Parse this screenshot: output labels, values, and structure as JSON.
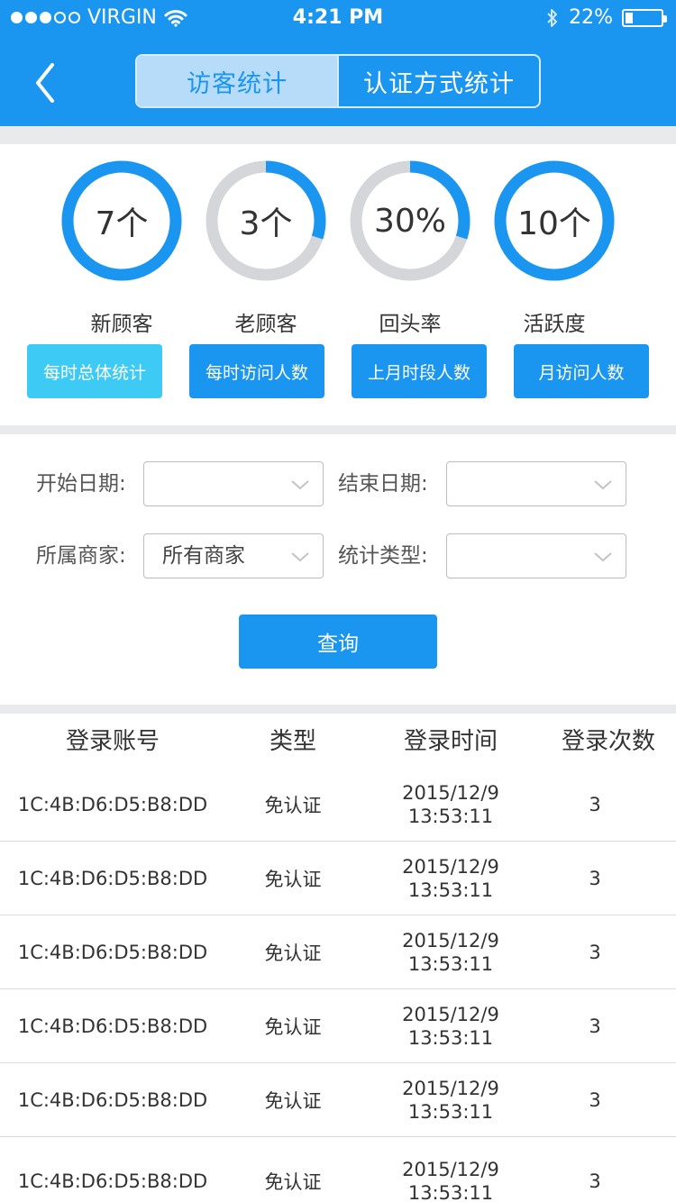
{
  "status_bar": {
    "carrier": "VIRGIN",
    "time": "4:21 PM",
    "battery": "22%",
    "battery_level": 0.22,
    "signal_bars_filled": 3,
    "signal_bars_total": 5
  },
  "nav": {
    "tabs": [
      {
        "label": "访客统计",
        "active": true
      },
      {
        "label": "认证方式统计",
        "active": false
      }
    ]
  },
  "stats": [
    {
      "value": "7个",
      "label": "新顾客",
      "progress": 1.0
    },
    {
      "value": "3个",
      "label": "老顾客",
      "progress": 0.3
    },
    {
      "value": "30%",
      "label": "回头率",
      "progress": 0.3
    },
    {
      "value": "10个",
      "label": "活跃度",
      "progress": 1.0
    }
  ],
  "stat_buttons": [
    {
      "label": "每时总体统计"
    },
    {
      "label": "每时访问人数"
    },
    {
      "label": "上月时段人数"
    },
    {
      "label": "月访问人数"
    }
  ],
  "filters": {
    "start_date_label": "开始日期:",
    "start_date_value": "",
    "end_date_label": "结束日期:",
    "end_date_value": "",
    "merchant_label": "所属商家:",
    "merchant_value": "所有商家",
    "type_label": "统计类型:",
    "type_value": "",
    "query_button": "查询"
  },
  "table": {
    "headers": [
      "登录账号",
      "类型",
      "登录时间",
      "登录次数"
    ],
    "rows": [
      {
        "account": "1C:4B:D6:D5:B8:DD",
        "type": "免认证",
        "date": "2015/12/9",
        "time": "13:53:11",
        "count": "3"
      },
      {
        "account": "1C:4B:D6:D5:B8:DD",
        "type": "免认证",
        "date": "2015/12/9",
        "time": "13:53:11",
        "count": "3"
      },
      {
        "account": "1C:4B:D6:D5:B8:DD",
        "type": "免认证",
        "date": "2015/12/9",
        "time": "13:53:11",
        "count": "3"
      },
      {
        "account": "1C:4B:D6:D5:B8:DD",
        "type": "免认证",
        "date": "2015/12/9",
        "time": "13:53:11",
        "count": "3"
      },
      {
        "account": "1C:4B:D6:D5:B8:DD",
        "type": "免认证",
        "date": "2015/12/9",
        "time": "13:53:11",
        "count": "3"
      },
      {
        "account": "1C:4B:D6:D5:B8:DD",
        "type": "免认证",
        "date": "2015/12/9",
        "time": "13:53:11",
        "count": "3"
      }
    ]
  },
  "colors": {
    "primary": "#1a96f0",
    "accent_light": "#3dcaf4",
    "ring_track": "#d4d6d9",
    "page_bg": "#e9eaec"
  },
  "icons": {
    "back": "chevron-left-icon",
    "wifi": "wifi-icon",
    "bluetooth": "bluetooth-icon",
    "battery": "battery-icon",
    "select": "chevron-down-icon"
  }
}
